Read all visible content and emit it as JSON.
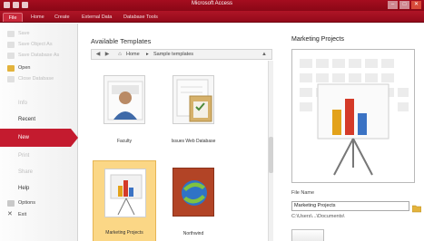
{
  "window": {
    "title": "Microsoft Access"
  },
  "ribbon": {
    "tabs": [
      "File",
      "Home",
      "Create",
      "External Data",
      "Database Tools"
    ]
  },
  "backstage": {
    "commands": [
      {
        "label": "Save",
        "icon": "save-icon",
        "enabled": false
      },
      {
        "label": "Save Object As",
        "icon": "save-object-icon",
        "enabled": false
      },
      {
        "label": "Save Database As",
        "icon": "save-database-icon",
        "enabled": false
      },
      {
        "label": "Open",
        "icon": "folder-open-icon",
        "enabled": true
      },
      {
        "label": "Close Database",
        "icon": "close-database-icon",
        "enabled": false
      }
    ],
    "sections": [
      {
        "label": "Info",
        "enabled": false
      },
      {
        "label": "Recent",
        "enabled": true
      },
      {
        "label": "New",
        "enabled": true,
        "selected": true
      },
      {
        "label": "Print",
        "enabled": false
      },
      {
        "label": "Share",
        "enabled": false
      },
      {
        "label": "Help",
        "enabled": true
      }
    ],
    "footer": [
      {
        "label": "Options",
        "icon": "options-icon"
      },
      {
        "label": "Exit",
        "icon": "exit-icon"
      }
    ]
  },
  "templates": {
    "heading": "Available Templates",
    "breadcrumb": [
      "Home",
      "Sample templates"
    ],
    "items": [
      {
        "label": "Faculty",
        "icon": "faculty-template-icon",
        "selected": false
      },
      {
        "label": "Issues Web Database",
        "icon": "issues-template-icon",
        "selected": false
      },
      {
        "label": "Marketing Projects",
        "icon": "marketing-projects-template-icon",
        "selected": true
      },
      {
        "label": "Northwind",
        "icon": "northwind-template-icon",
        "selected": false
      }
    ]
  },
  "preview": {
    "title": "Marketing Projects",
    "file_name_label": "File Name",
    "file_name": "Marketing Projects",
    "path": "C:\\Users\\...\\Documents\\"
  },
  "colors": {
    "accent": "#c41b2f",
    "selection": "#fbd786"
  }
}
